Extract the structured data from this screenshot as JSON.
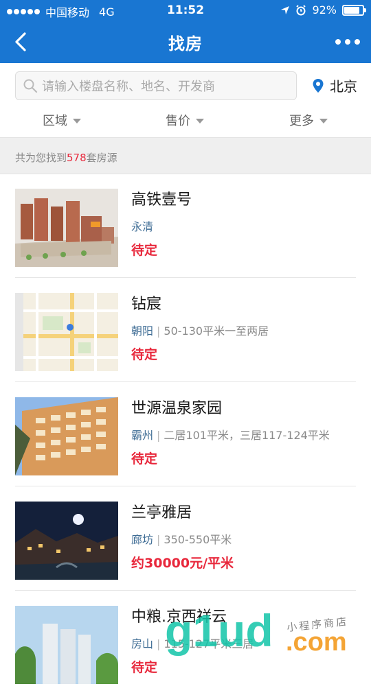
{
  "status_bar": {
    "carrier": "中国移动",
    "network": "4G",
    "time": "11:52",
    "battery": "92%",
    "battery_level": 0.92
  },
  "nav": {
    "title": "找房",
    "back_icon": "chevron-left-icon",
    "more_icon": "more-horizontal-icon"
  },
  "search": {
    "placeholder": "请输入楼盘名称、地名、开发商",
    "city": "北京"
  },
  "filters": [
    "区域",
    "售价",
    "更多"
  ],
  "result_count": {
    "prefix": "共为您找到",
    "count": "578",
    "suffix": "套房源"
  },
  "listings": [
    {
      "name": "高铁壹号",
      "district": "永清",
      "spec": "",
      "price": "待定"
    },
    {
      "name": "钻宸",
      "district": "朝阳",
      "spec": "50-130平米一至两居",
      "price": "待定"
    },
    {
      "name": "世源温泉家园",
      "district": "霸州",
      "spec": "二居101平米，三居117-124平米",
      "price": "待定"
    },
    {
      "name": "兰亭雅居",
      "district": "廊坊",
      "spec": "350-550平米",
      "price": "约30000元/平米"
    },
    {
      "name": "中粮.京西祥云",
      "district": "房山",
      "spec": "115-127平米三居",
      "price": "待定"
    }
  ],
  "watermark": {
    "brand": "g1ud",
    "domain": ".com",
    "tagline": "小程序商店"
  },
  "colors": {
    "primary": "#1976d2",
    "price_red": "#e8283c",
    "district_blue": "#3f6d95",
    "watermark_teal": "#12c4a8"
  }
}
